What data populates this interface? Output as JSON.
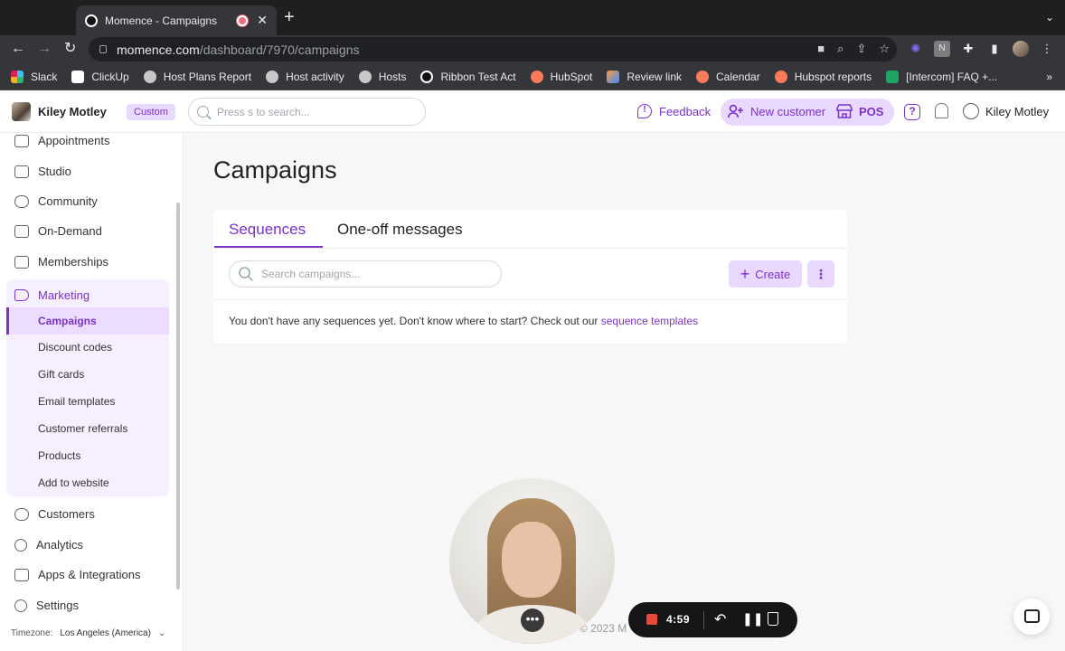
{
  "browser": {
    "tab_title": "Momence - Campaigns",
    "url_host": "momence.com",
    "url_path": "/dashboard/7970/campaigns",
    "bookmarks": [
      {
        "label": "Slack",
        "color": "#e01e5a"
      },
      {
        "label": "ClickUp",
        "color": "#f0f0f0"
      },
      {
        "label": "Host Plans Report",
        "color": "#c8c8c8"
      },
      {
        "label": "Host activity",
        "color": "#c8c8c8"
      },
      {
        "label": "Hosts",
        "color": "#c8c8c8"
      },
      {
        "label": "Ribbon Test Act",
        "color": "#111111"
      },
      {
        "label": "HubSpot",
        "color": "#ff7a59"
      },
      {
        "label": "Review link",
        "color": "#ff9d3a"
      },
      {
        "label": "Calendar",
        "color": "#ff7a59"
      },
      {
        "label": "Hubspot reports",
        "color": "#ff7a59"
      },
      {
        "label": "[Intercom] FAQ +...",
        "color": "#1fa463"
      }
    ],
    "bookmarks_more": "»"
  },
  "header": {
    "account_name": "Kiley Motley",
    "badge": "Custom",
    "search_placeholder": "Press s to search...",
    "feedback": "Feedback",
    "new_customer": "New customer",
    "pos": "POS",
    "user_name": "Kiley Motley"
  },
  "sidebar": {
    "items_top": [
      "Appointments",
      "Studio",
      "Community",
      "On-Demand",
      "Memberships"
    ],
    "marketing": {
      "label": "Marketing",
      "active": "Campaigns",
      "subitems": [
        "Discount codes",
        "Gift cards",
        "Email templates",
        "Customer referrals",
        "Products",
        "Add to website"
      ]
    },
    "items_bottom": [
      "Customers",
      "Analytics",
      "Apps & Integrations",
      "Settings"
    ],
    "timezone_label": "Timezone:",
    "timezone_value": "Los Angeles (America)"
  },
  "main": {
    "title": "Campaigns",
    "tabs": [
      "Sequences",
      "One-off messages"
    ],
    "search_placeholder": "Search campaigns...",
    "create_label": "Create",
    "empty_text": "You don't have any sequences yet. Don't know where to start? Check out our ",
    "empty_link": "sequence templates",
    "footer_text": "© 2023 M"
  },
  "recorder": {
    "time": "4:59"
  },
  "colors": {
    "accent": "#7b32c6",
    "accent_light": "#e9d8ff",
    "record": "#e64a3b"
  }
}
